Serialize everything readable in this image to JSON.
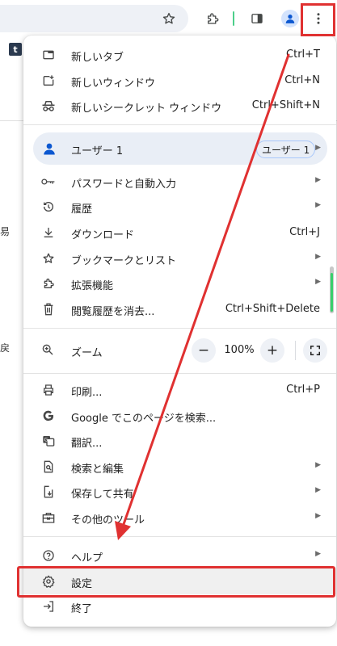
{
  "page": {
    "edge_text_1": "易",
    "edge_text_2": "戻",
    "bookmark_tumblr_glyph": "t"
  },
  "toolbar": {
    "icons": [
      "star-icon",
      "extensions-icon",
      "side-panel-icon",
      "profile-icon",
      "more-menu-icon"
    ]
  },
  "menu": {
    "new_tab": {
      "label": "新しいタブ",
      "shortcut": "Ctrl+T"
    },
    "new_window": {
      "label": "新しいウィンドウ",
      "shortcut": "Ctrl+N"
    },
    "incognito": {
      "label": "新しいシークレット ウィンドウ",
      "shortcut": "Ctrl+Shift+N"
    },
    "user": {
      "label": "ユーザー 1",
      "chip": "ユーザー 1"
    },
    "passwords": {
      "label": "パスワードと自動入力"
    },
    "history": {
      "label": "履歴"
    },
    "downloads": {
      "label": "ダウンロード",
      "shortcut": "Ctrl+J"
    },
    "bookmarks": {
      "label": "ブックマークとリスト"
    },
    "extensions": {
      "label": "拡張機能"
    },
    "clear_data": {
      "label": "閲覧履歴を消去...",
      "shortcut": "Ctrl+Shift+Delete"
    },
    "zoom": {
      "label": "ズーム",
      "minus": "−",
      "value": "100%",
      "plus": "+"
    },
    "print": {
      "label": "印刷...",
      "shortcut": "Ctrl+P"
    },
    "google_search": {
      "label": "Google でこのページを検索..."
    },
    "translate": {
      "label": "翻訳..."
    },
    "find_edit": {
      "label": "検索と編集"
    },
    "save_share": {
      "label": "保存して共有"
    },
    "more_tools": {
      "label": "その他のツール"
    },
    "help": {
      "label": "ヘルプ"
    },
    "settings": {
      "label": "設定"
    },
    "exit": {
      "label": "終了"
    }
  },
  "colors": {
    "annotation_red": "#e03131",
    "accent_blue": "#0b57d0",
    "menu_hover": "#f0f0f0",
    "user_row_bg": "#e9eef6"
  }
}
